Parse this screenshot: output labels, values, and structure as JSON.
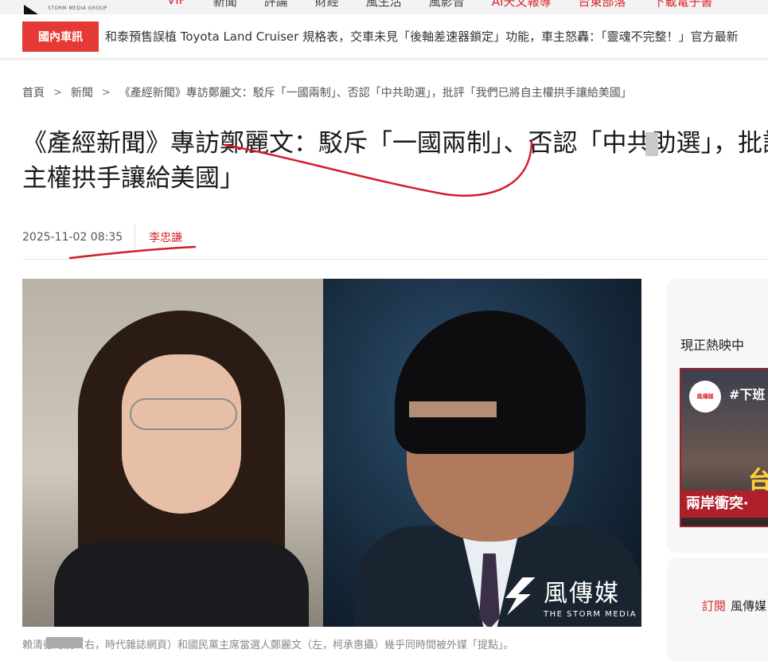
{
  "header": {
    "logo_text": "STORM MEDIA GROUP",
    "nav": [
      "VIP",
      "新聞",
      "評論",
      "財經",
      "風生活",
      "風影音",
      "AI天文報導",
      "台東部落",
      "下載電子書"
    ]
  },
  "ticker": {
    "badge": "國內車訊",
    "text": "和泰預售誤植 Toyota Land Cruiser 規格表，交車未見「後軸差速器鎖定」功能，車主怒轟：「靈魂不完整！」官方最新"
  },
  "breadcrumb": {
    "home": "首頁",
    "section": "新聞",
    "current": "《產經新聞》專訪鄭麗文：駁斥「一國兩制」、否認「中共助選」，批評「我們已將自主權拱手讓給美國」",
    "separator": "＞"
  },
  "article": {
    "title_line1": "《產經新聞》專訪鄭麗文：駁斥「一國兩制」、否認「中共助選」，批評「我們已將自",
    "title_line2": "主權拱手讓給美國」",
    "date": "2025-11-02 08:35",
    "author": "李忠謙",
    "caption": "賴清德總統（右，時代雜誌網頁）和國民黨主席當選人鄭麗文（左，柯承惠攝）幾乎同時間被外媒「提點」。"
  },
  "photo": {
    "watermark_cn": "風傳媒",
    "watermark_en": "THE STORM MEDIA"
  },
  "sidebar": {
    "title": "現正熱映中",
    "video": {
      "badge": "風傳媒",
      "tag": "#下班",
      "big": "台灣",
      "bottom": "兩岸衝突‧"
    },
    "subscribe_label": "訂閱",
    "subscribe_name": "風傳媒"
  },
  "colors": {
    "accent": "#d9262c",
    "ticker_badge": "#e53935",
    "annotation": "#d11f2a"
  }
}
